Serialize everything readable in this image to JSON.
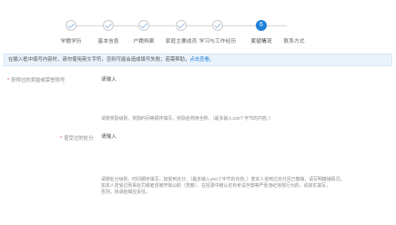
{
  "steps": [
    {
      "label": "学籍学历",
      "state": "done"
    },
    {
      "label": "基本信息",
      "state": "done"
    },
    {
      "label": "户籍档案",
      "state": "done"
    },
    {
      "label": "家庭主要成员",
      "state": "done"
    },
    {
      "label": "学习与工作经历",
      "state": "done"
    },
    {
      "label": "奖惩情况",
      "state": "active",
      "number": "6"
    },
    {
      "label": "联系方式",
      "state": "pending"
    }
  ],
  "notice": {
    "text": "在输入框中填写内容时，请勿使用英文字符，否则可能会造成填写失败；若需帮助，",
    "link": "点击查看。"
  },
  "form": {
    "rewards": {
      "label": "获得过的奖励或荣誉称号",
      "placeholder": "请输入",
      "hint": [
        "请按奖励级别、奖励时间等顺序填写，奖励名称用全称。（最多输入200个字节的内容。）"
      ]
    },
    "punishments": {
      "label": "曾受过的处分",
      "placeholder": "请输入",
      "hint": [
        "请按处分级别、时间顺序填写，如受到处分，（最多输入200个字节的内容。）若本人受到过处分且已撤销，请写明撤销情况，",
        "如本人曾受过刑事处罚或者曾被开除公职（党籍）、在招录中被认定有考试作弊等严重违纪违规行为的，请如实填写，",
        "否则，将承担相应责任。"
      ]
    }
  }
}
